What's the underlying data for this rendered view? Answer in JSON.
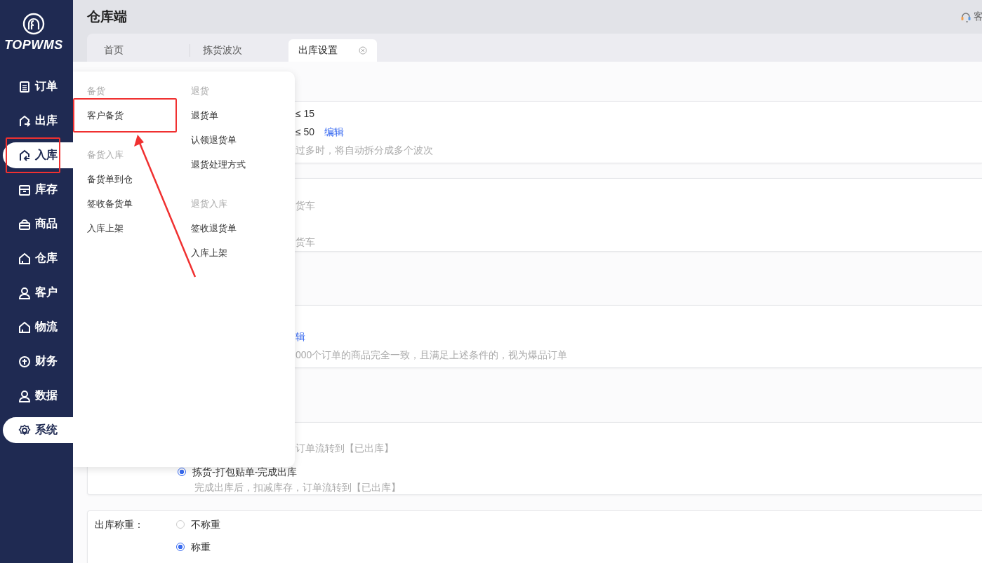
{
  "brand": {
    "name": "TOPWMS"
  },
  "sidebar": {
    "items": [
      {
        "label": "订单",
        "selected": false,
        "expanded": false,
        "marked": false
      },
      {
        "label": "出库",
        "selected": false,
        "expanded": false,
        "marked": false
      },
      {
        "label": "入库",
        "selected": false,
        "expanded": true,
        "marked": true
      },
      {
        "label": "库存",
        "selected": false,
        "expanded": false,
        "marked": false
      },
      {
        "label": "商品",
        "selected": false,
        "expanded": false,
        "marked": false
      },
      {
        "label": "仓库",
        "selected": false,
        "expanded": false,
        "marked": false
      },
      {
        "label": "客户",
        "selected": false,
        "expanded": false,
        "marked": false
      },
      {
        "label": "物流",
        "selected": false,
        "expanded": false,
        "marked": false
      },
      {
        "label": "财务",
        "selected": false,
        "expanded": false,
        "marked": false
      },
      {
        "label": "数据",
        "selected": false,
        "expanded": false,
        "marked": false
      },
      {
        "label": "系统",
        "selected": true,
        "expanded": false,
        "marked": false
      }
    ]
  },
  "header": {
    "title": "仓库端",
    "support": "客"
  },
  "tabs": [
    {
      "label": "首页",
      "selected": false
    },
    {
      "label": "拣货波次",
      "selected": false
    },
    {
      "label": "出库设置",
      "selected": true,
      "closable": true
    }
  ],
  "menu": {
    "columns": [
      {
        "groups": [
          {
            "title": "备货",
            "items": [
              {
                "label": "客户备货",
                "marked": true
              }
            ]
          },
          {
            "title": "备货入库",
            "items": [
              {
                "label": "备货单到仓",
                "marked": false
              },
              {
                "label": "签收备货单",
                "marked": false
              },
              {
                "label": "入库上架",
                "marked": false
              }
            ]
          }
        ]
      },
      {
        "groups": [
          {
            "title": "退货",
            "items": [
              {
                "label": "退货单",
                "marked": false
              },
              {
                "label": "认领退货单",
                "marked": false
              },
              {
                "label": "退货处理方式",
                "marked": false
              }
            ]
          },
          {
            "title": "退货入库",
            "items": [
              {
                "label": "签收退货单",
                "marked": false
              },
              {
                "label": "入库上架",
                "marked": false
              }
            ]
          }
        ]
      }
    ]
  },
  "cards": [
    {
      "lines": [
        {
          "kind": "text",
          "text": "≤ 15"
        },
        {
          "kind": "text",
          "text": "≤ 50",
          "link": "编辑"
        },
        {
          "kind": "hint",
          "text": "过多时，将自动拆分成多个波次"
        }
      ]
    },
    {
      "lines": [
        {
          "kind": "hint",
          "text": "货车"
        },
        {
          "kind": "hint",
          "text": "货车"
        }
      ]
    },
    {
      "lines": [
        {
          "kind": "link",
          "text": "辑"
        },
        {
          "kind": "hint",
          "text": "000个订单的商品完全一致，且满足上述条件的，视为爆品订单"
        }
      ]
    },
    {
      "lines": [
        {
          "kind": "hint",
          "text": "订单流转到【已出库】"
        },
        {
          "kind": "radio",
          "text": "拣货-打包贴单-完成出库",
          "selected": true
        },
        {
          "kind": "subhint",
          "text": "完成出库后，扣减库存，订单流转到【已出库】"
        }
      ]
    },
    {
      "label": "出库称重：",
      "lines": [
        {
          "kind": "radio",
          "text": "不称重",
          "selected": false
        },
        {
          "kind": "radio",
          "text": "称重",
          "selected": true
        }
      ]
    }
  ]
}
